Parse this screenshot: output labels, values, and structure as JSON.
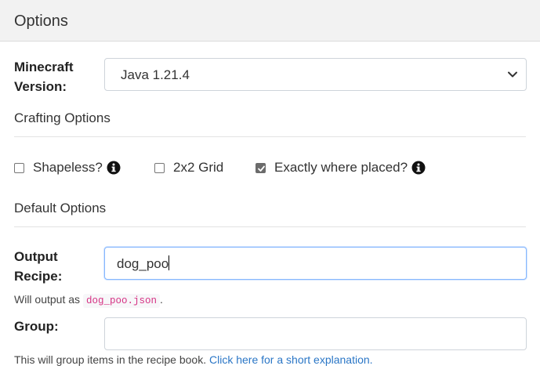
{
  "header": {
    "title": "Options"
  },
  "version": {
    "label": "Minecraft Version:",
    "selected": "Java 1.21.4"
  },
  "crafting": {
    "title": "Crafting Options",
    "shapeless": {
      "label": "Shapeless?",
      "checked": false
    },
    "grid2x2": {
      "label": "2x2 Grid",
      "checked": false
    },
    "exact": {
      "label": "Exactly where placed?",
      "checked": true
    }
  },
  "defaults": {
    "title": "Default Options",
    "output": {
      "label": "Output Recipe:",
      "value": "dog_poo",
      "help_prefix": "Will output as",
      "help_code": "dog_poo.json",
      "help_suffix": "."
    },
    "group": {
      "label": "Group:",
      "value": "",
      "help_text": "This will group items in the recipe book.",
      "help_link": "Click here for a short explanation."
    }
  },
  "colors": {
    "header_bg": "#f2f2f2",
    "link": "#2a76c6",
    "code": "#d63384",
    "focus_border": "#86b7fe"
  }
}
